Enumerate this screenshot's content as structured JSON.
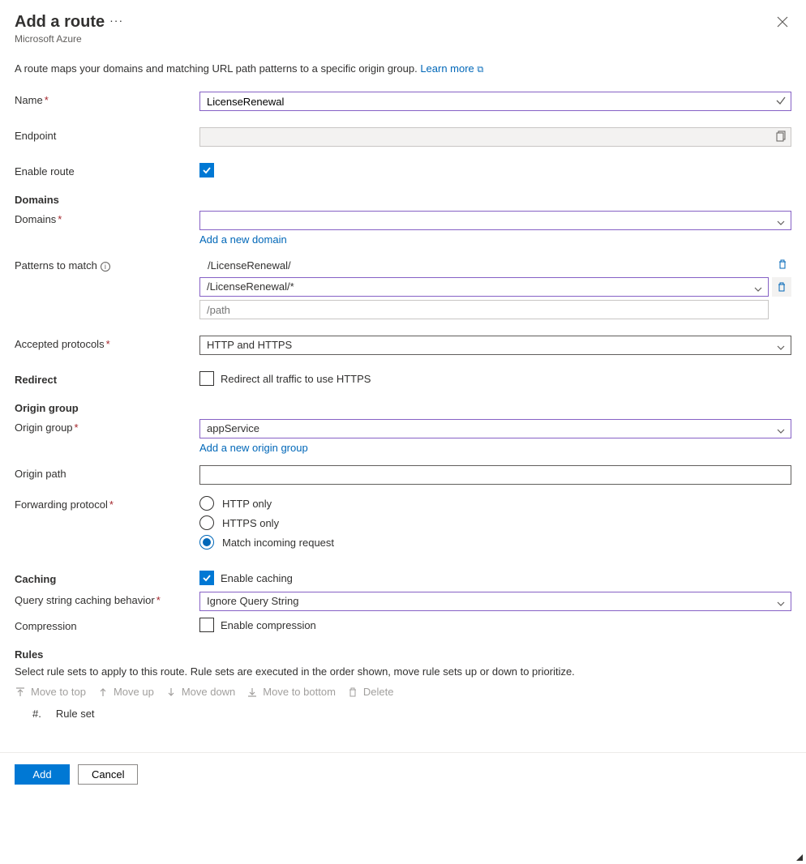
{
  "header": {
    "title": "Add a route",
    "subtitle": "Microsoft Azure"
  },
  "description": "A route maps your domains and matching URL path patterns to a specific origin group.",
  "learn_more": "Learn more",
  "fields": {
    "name": {
      "label": "Name",
      "value": "LicenseRenewal"
    },
    "endpoint": {
      "label": "Endpoint",
      "value": ""
    },
    "enable_route": {
      "label": "Enable route",
      "checked": true
    }
  },
  "domains": {
    "section": "Domains",
    "label": "Domains",
    "value": "",
    "add_link": "Add a new domain"
  },
  "patterns": {
    "label": "Patterns to match",
    "static": "/LicenseRenewal/",
    "selected": "/LicenseRenewal/*",
    "placeholder": "/path"
  },
  "protocols": {
    "label": "Accepted protocols",
    "value": "HTTP and HTTPS"
  },
  "redirect": {
    "section": "Redirect",
    "checkbox_label": "Redirect all traffic to use HTTPS",
    "checked": false
  },
  "origin": {
    "section": "Origin group",
    "group_label": "Origin group",
    "group_value": "appService",
    "add_link": "Add a new origin group",
    "path_label": "Origin path",
    "path_value": ""
  },
  "forwarding": {
    "label": "Forwarding protocol",
    "options": {
      "http": "HTTP only",
      "https": "HTTPS only",
      "match": "Match incoming request"
    },
    "selected": "match"
  },
  "caching": {
    "section": "Caching",
    "enable_label": "Enable caching",
    "enable_checked": true,
    "qs_label": "Query string caching behavior",
    "qs_value": "Ignore Query String",
    "compression_label": "Compression",
    "compression_cb_label": "Enable compression",
    "compression_checked": false
  },
  "rules": {
    "section": "Rules",
    "desc": "Select rule sets to apply to this route. Rule sets are executed in the order shown, move rule sets up or down to prioritize.",
    "toolbar": {
      "top": "Move to top",
      "up": "Move up",
      "down": "Move down",
      "bottom": "Move to bottom",
      "delete": "Delete"
    },
    "col_num": "#.",
    "col_name": "Rule set"
  },
  "footer": {
    "add": "Add",
    "cancel": "Cancel"
  }
}
